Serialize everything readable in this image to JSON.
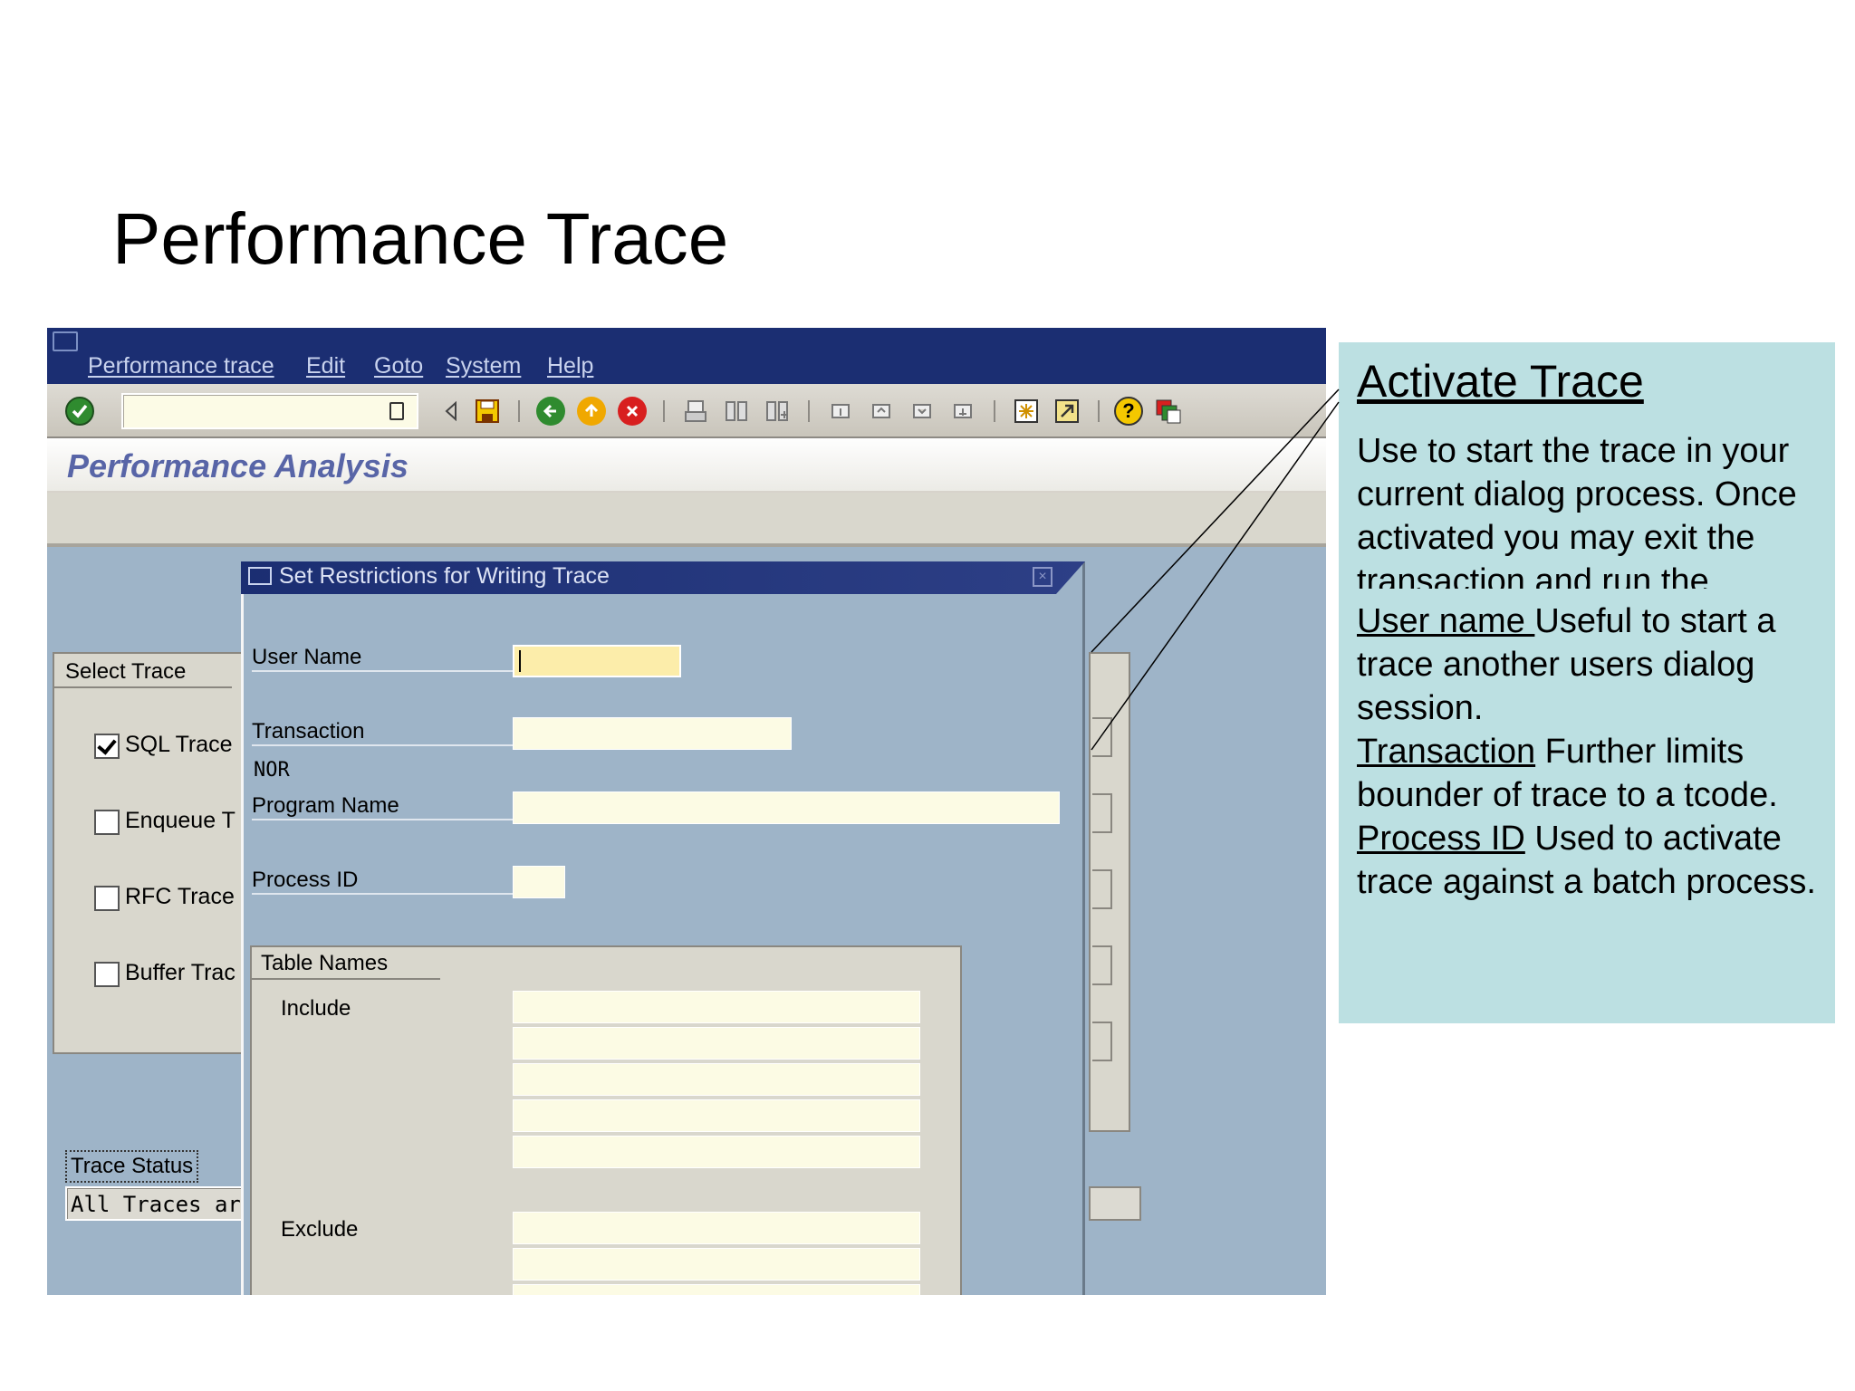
{
  "slide": {
    "title": "Performance Trace"
  },
  "sap": {
    "menu": [
      "Performance trace",
      "Edit",
      "Goto",
      "System",
      "Help"
    ],
    "app_title": "Performance Analysis",
    "select_trace": {
      "tab_label": "Select Trace",
      "options": [
        {
          "label": "SQL Trace",
          "checked": true
        },
        {
          "label": "Enqueue T",
          "checked": false
        },
        {
          "label": "RFC Trace",
          "checked": false
        },
        {
          "label": "Buffer Trac",
          "checked": false
        }
      ]
    },
    "trace_status": {
      "label": "Trace Status",
      "value": "All Traces ar"
    },
    "popup": {
      "title": "Set Restrictions for Writing Trace",
      "fields": {
        "user_name": "User Name",
        "transaction": "Transaction",
        "program_name": "Program Name",
        "process_id": "Process ID"
      },
      "nor": "NOR",
      "table_names": {
        "tab_label": "Table Names",
        "include": "Include",
        "exclude": "Exclude"
      }
    }
  },
  "callout": {
    "heading": "Activate Trace",
    "intro": "Use to start the trace in your current dialog process. Once activated you may exit the transaction and run the",
    "user_name_term": "User name ",
    "user_name_text": "Useful to start a trace another users dialog session.",
    "transaction_term": "Transaction",
    "transaction_text": " Further limits bounder of trace to a tcode.",
    "process_id_term": "Process ID",
    "process_id_text": " Used to activate trace against a batch process."
  },
  "colors": {
    "sap_title_bar": "#1b2e72",
    "sap_screen_bg": "#9eb4c8",
    "field_yellow": "#fcedaa",
    "callout_bg": "#bce0e2"
  }
}
